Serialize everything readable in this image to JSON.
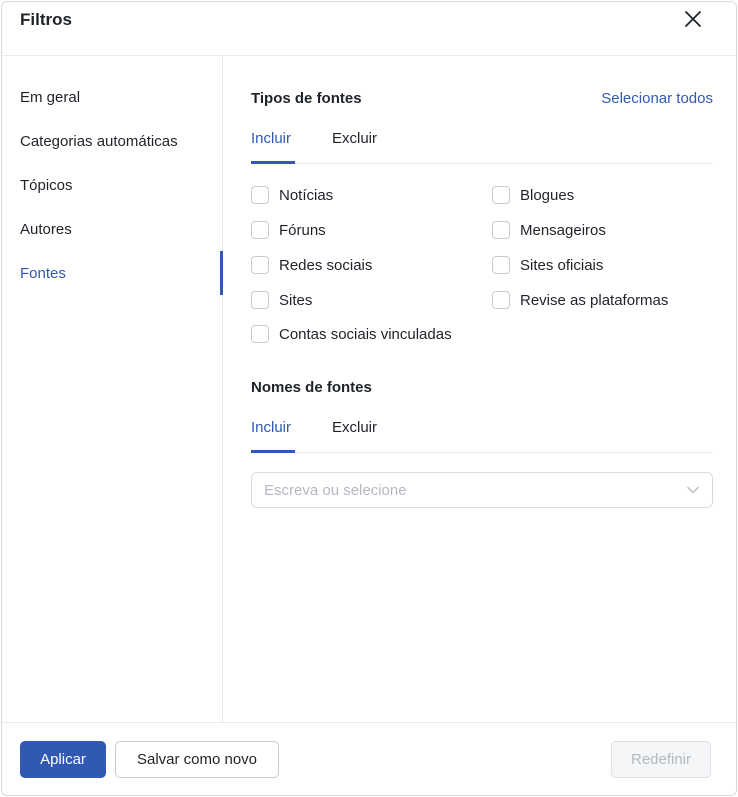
{
  "dialog": {
    "title": "Filtros"
  },
  "sidebar": {
    "items": [
      {
        "label": "Em geral"
      },
      {
        "label": "Categorias automáticas"
      },
      {
        "label": "Tópicos"
      },
      {
        "label": "Autores"
      },
      {
        "label": "Fontes"
      }
    ],
    "active_item": "Fontes"
  },
  "source_types": {
    "title": "Tipos de fontes",
    "select_all": "Selecionar todos",
    "tabs": [
      {
        "label": "Incluir"
      },
      {
        "label": "Excluir"
      }
    ],
    "active_tab": "Incluir",
    "options": [
      {
        "label": "Notícias",
        "checked": false
      },
      {
        "label": "Blogues",
        "checked": false
      },
      {
        "label": "Fóruns",
        "checked": false
      },
      {
        "label": "Mensageiros",
        "checked": false
      },
      {
        "label": "Redes sociais",
        "checked": false
      },
      {
        "label": "Sites oficiais",
        "checked": false
      },
      {
        "label": "Sites",
        "checked": false
      },
      {
        "label": "Revise as plataformas",
        "checked": false
      },
      {
        "label": "Contas sociais vinculadas",
        "checked": false
      }
    ]
  },
  "source_names": {
    "title": "Nomes de fontes",
    "tabs": [
      {
        "label": "Incluir"
      },
      {
        "label": "Excluir"
      }
    ],
    "active_tab": "Incluir",
    "input": {
      "value": "",
      "placeholder": "Escreva ou selecione"
    }
  },
  "footer": {
    "apply_label": "Aplicar",
    "save_new_label": "Salvar como novo",
    "reset_label": "Redefinir"
  },
  "colors": {
    "accent": "#3159b3",
    "border": "#e8eaed",
    "text": "#1f2329",
    "placeholder": "#b5b9bf"
  }
}
